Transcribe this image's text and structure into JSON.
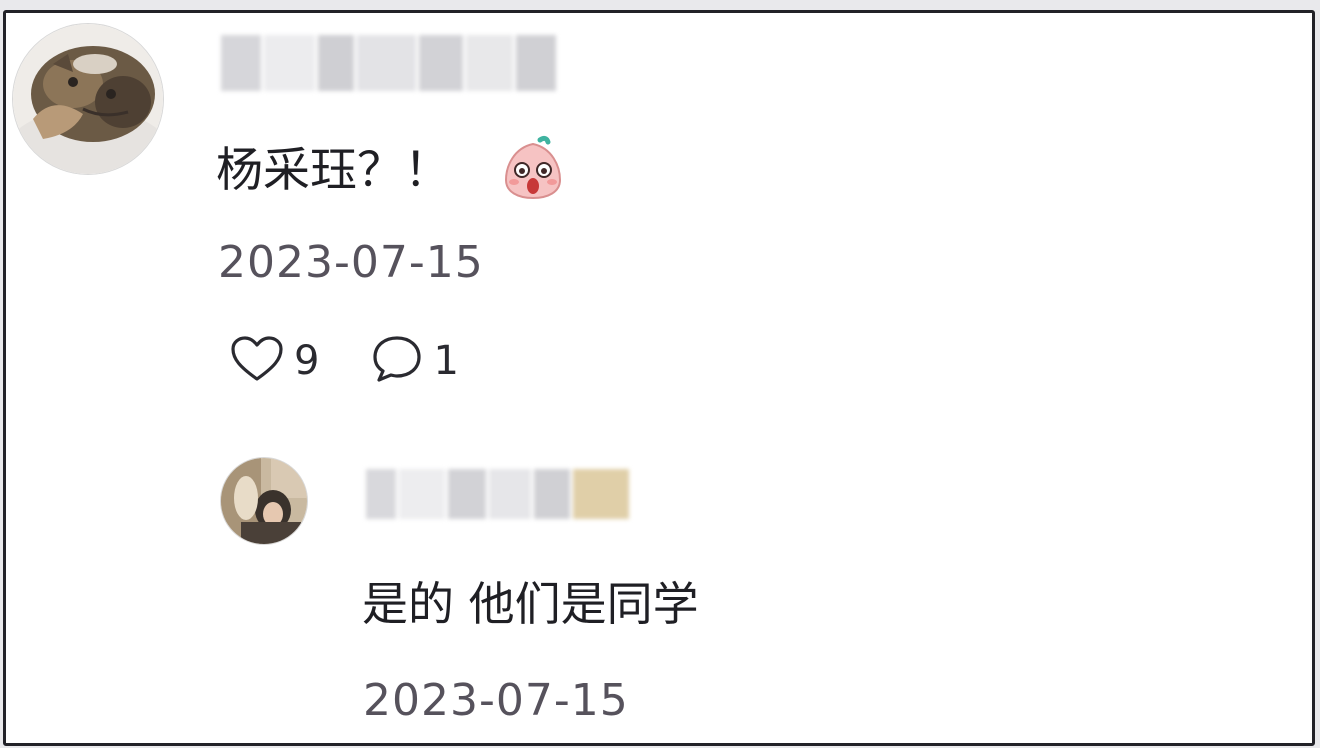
{
  "comment": {
    "author": "",
    "text": "杨采珏？！",
    "emoji": "surprised-face-emoji",
    "date": "2023-07-15",
    "likes": "9",
    "replies": "1"
  },
  "reply": {
    "author": "",
    "text": "是的 他们是同学",
    "date": "2023-07-15"
  },
  "colors": {
    "text": "#1f1f24",
    "date": "#56525c",
    "frame_border": "#222228"
  }
}
